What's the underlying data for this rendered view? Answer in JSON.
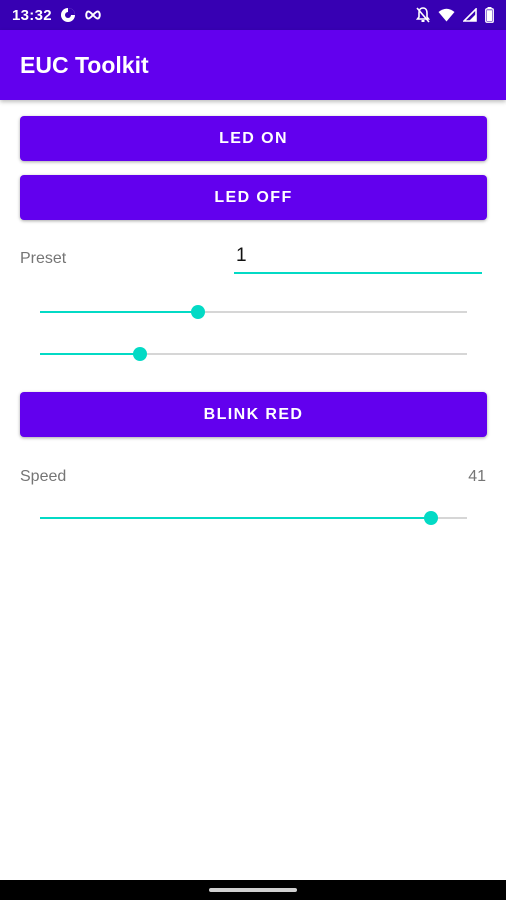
{
  "status_bar": {
    "time": "13:32",
    "icons": [
      "data-saver-icon",
      "infinity-icon",
      "notifications-off-icon",
      "wifi-icon",
      "signal-icon",
      "battery-icon"
    ]
  },
  "app_bar": {
    "title": "EUC Toolkit"
  },
  "buttons": {
    "led_on": "LED ON",
    "led_off": "LED OFF",
    "blink_red": "BLINK RED"
  },
  "preset": {
    "label": "Preset",
    "value": "1"
  },
  "sliders": {
    "slider_1": 0.37,
    "slider_2": 0.235,
    "speed": 0.915
  },
  "speed": {
    "label": "Speed",
    "value": "41"
  },
  "colors": {
    "primary": "#6200ee",
    "primary_dark": "#3700b3",
    "accent": "#03dac5"
  }
}
